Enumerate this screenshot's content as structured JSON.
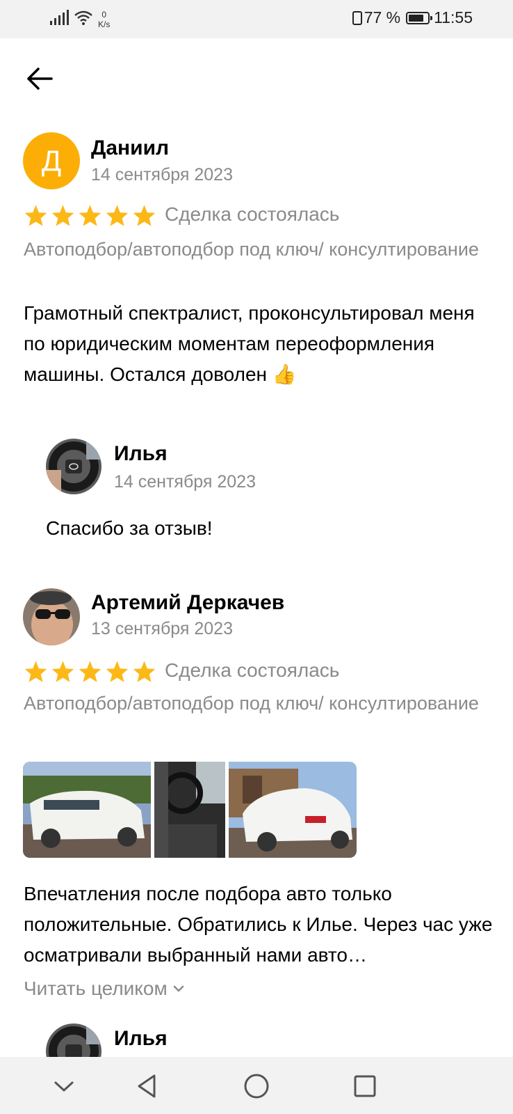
{
  "status_bar": {
    "net_speed_value": "0",
    "net_speed_unit": "K/s",
    "battery": "77 %",
    "time": "11:55"
  },
  "icons": {
    "back": "back-arrow-icon",
    "star": "star-icon",
    "thumbs_up": "thumbs-up-emoji",
    "chevron": "chevron-down-icon"
  },
  "colors": {
    "star": "#fcb816",
    "avatar_bg": "#fcae07",
    "secondary_text": "#8a8a8a"
  },
  "reviews": [
    {
      "avatar_letter": "Д",
      "author": "Даниил",
      "date": "14 сентября 2023",
      "rating": 5,
      "deal_status": "Сделка состоялась",
      "category": "Автоподбор/автоподбор под ключ/ консултирование",
      "text": "Грамотный спектралист, проконсультировал меня по юридическим моментам переоформления машины. Остался доволен 👍",
      "reply": {
        "author": "Илья",
        "date": "14 сентября 2023",
        "text": "Спасибо за отзыв!"
      }
    },
    {
      "author": "Артемий Деркачев",
      "date": "13 сентября 2023",
      "rating": 5,
      "deal_status": "Сделка состоялась",
      "category": "Автоподбор/автоподбор под ключ/ консултирование",
      "photos_count": 3,
      "text": "Впечатления после подбора авто только положительные. Обратились к  Илье. Через час уже осматривали выбранный нами авто…",
      "read_more": "Читать целиком",
      "reply": {
        "author": "Илья"
      }
    }
  ]
}
